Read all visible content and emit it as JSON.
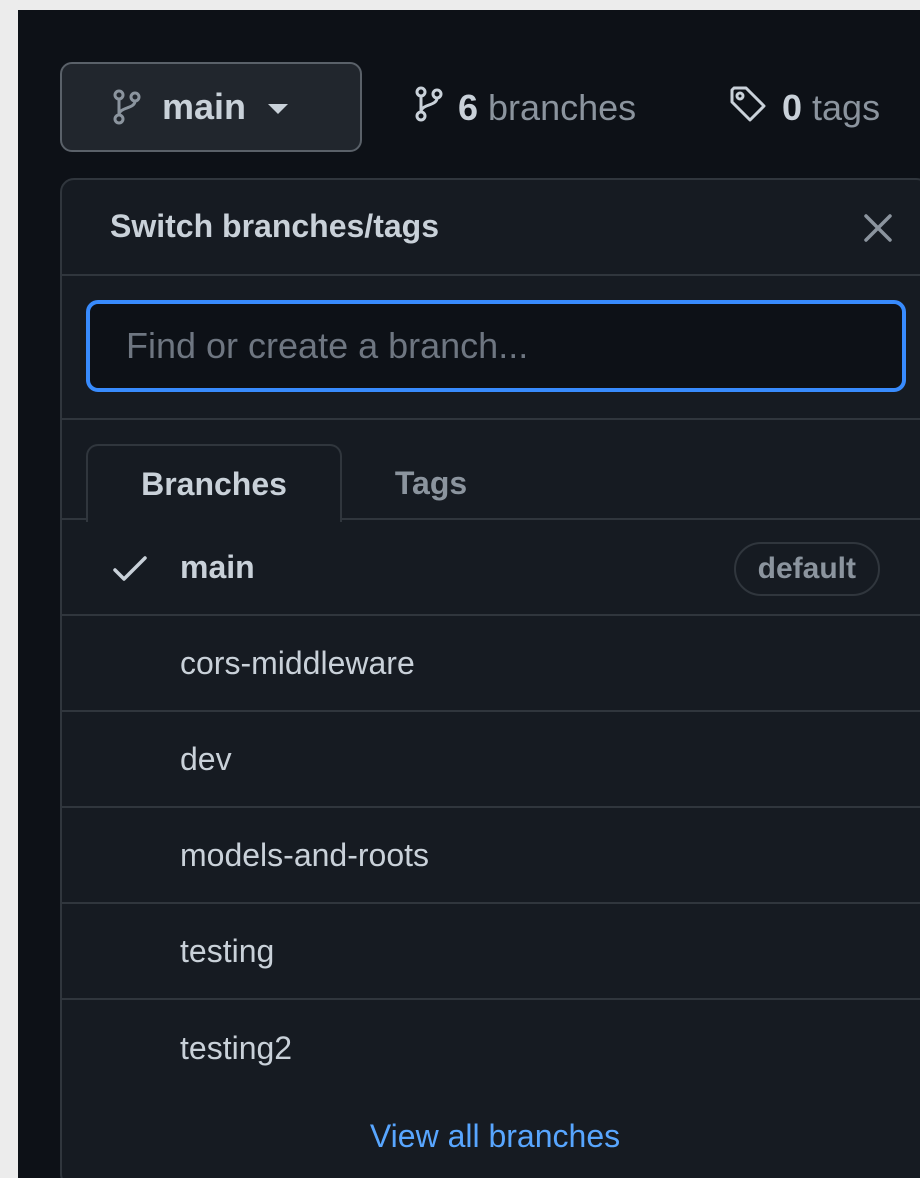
{
  "header": {
    "current_branch": "main",
    "branches_count": "6",
    "branches_label": "branches",
    "tags_count": "0",
    "tags_label": "tags"
  },
  "dropdown": {
    "title": "Switch branches/tags",
    "search_placeholder": "Find or create a branch...",
    "tabs": [
      {
        "label": "Branches",
        "active": true
      },
      {
        "label": "Tags",
        "active": false
      }
    ],
    "branches": [
      {
        "name": "main",
        "selected": true,
        "badge": "default"
      },
      {
        "name": "cors-middleware"
      },
      {
        "name": "dev"
      },
      {
        "name": "models-and-roots"
      },
      {
        "name": "testing"
      },
      {
        "name": "testing2"
      }
    ],
    "view_all_label": "View all branches"
  },
  "colors": {
    "background": "#0d1117",
    "panel": "#161b22",
    "border": "#30363d",
    "text": "#c9d1d9",
    "muted": "#8b949e",
    "link": "#58a6ff",
    "focus": "#388bfd"
  },
  "icons": {
    "branch": "git-branch-icon",
    "tag": "tag-icon",
    "close": "close-icon",
    "check": "check-icon",
    "caret": "caret-down-icon"
  }
}
